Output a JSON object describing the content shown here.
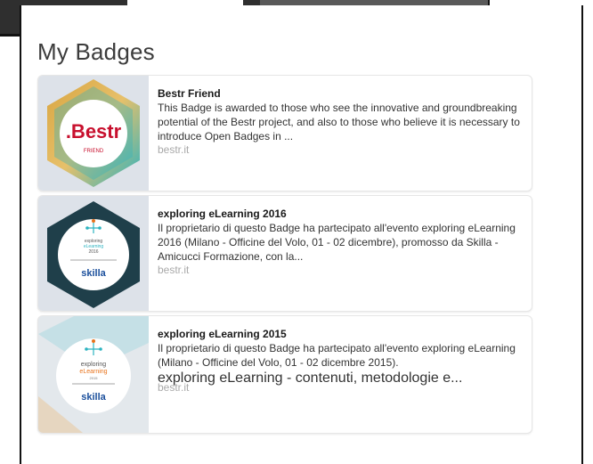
{
  "panel": {
    "title": "My Badges"
  },
  "badges": [
    {
      "title": "Bestr Friend",
      "description": "This Badge is awarded to those who see the innovative and groundbreaking potential of the Bestr project, and also to those who believe it is necessary to introduce Open Badges in ...",
      "source": "bestr.it",
      "image": {
        "brand": ".Bestr",
        "caption": "FRIEND",
        "icon": "bestr-hexagon-badge-icon"
      }
    },
    {
      "title": "exploring eLearning 2016",
      "description": "Il proprietario di questo Badge ha partecipato all'evento exploring eLearning 2016 (Milano - Officine del Volo, 01 - 02 dicembre), promosso da Skilla - Amicucci Formazione, con la...",
      "source": "bestr.it",
      "image": {
        "line1": "exploring",
        "line2": "eLearning",
        "year": "2016",
        "brand": "skilla",
        "icon": "exploring-elearning-2016-badge-icon"
      }
    },
    {
      "title": "exploring eLearning 2015",
      "description": "Il proprietario di questo Badge ha partecipato all'evento exploring eLearning (Milano - Officine del Volo, 01 - 02 dicembre 2015).",
      "extra": "exploring eLearning - contenuti, metodologie e...",
      "source": "bestr.it",
      "image": {
        "line1": "exploring",
        "line2": "eLearning",
        "year": "2015",
        "brand": "skilla",
        "icon": "exploring-elearning-2015-badge-icon"
      }
    }
  ],
  "colors": {
    "bestr_red": "#c8102e",
    "hex_teal": "#2bb3c0",
    "hex_gold": "#d8a541",
    "dark_hex": "#1f3f4a",
    "elearning_orange": "#e8731c",
    "skilla_blue": "#1b4f9c"
  }
}
